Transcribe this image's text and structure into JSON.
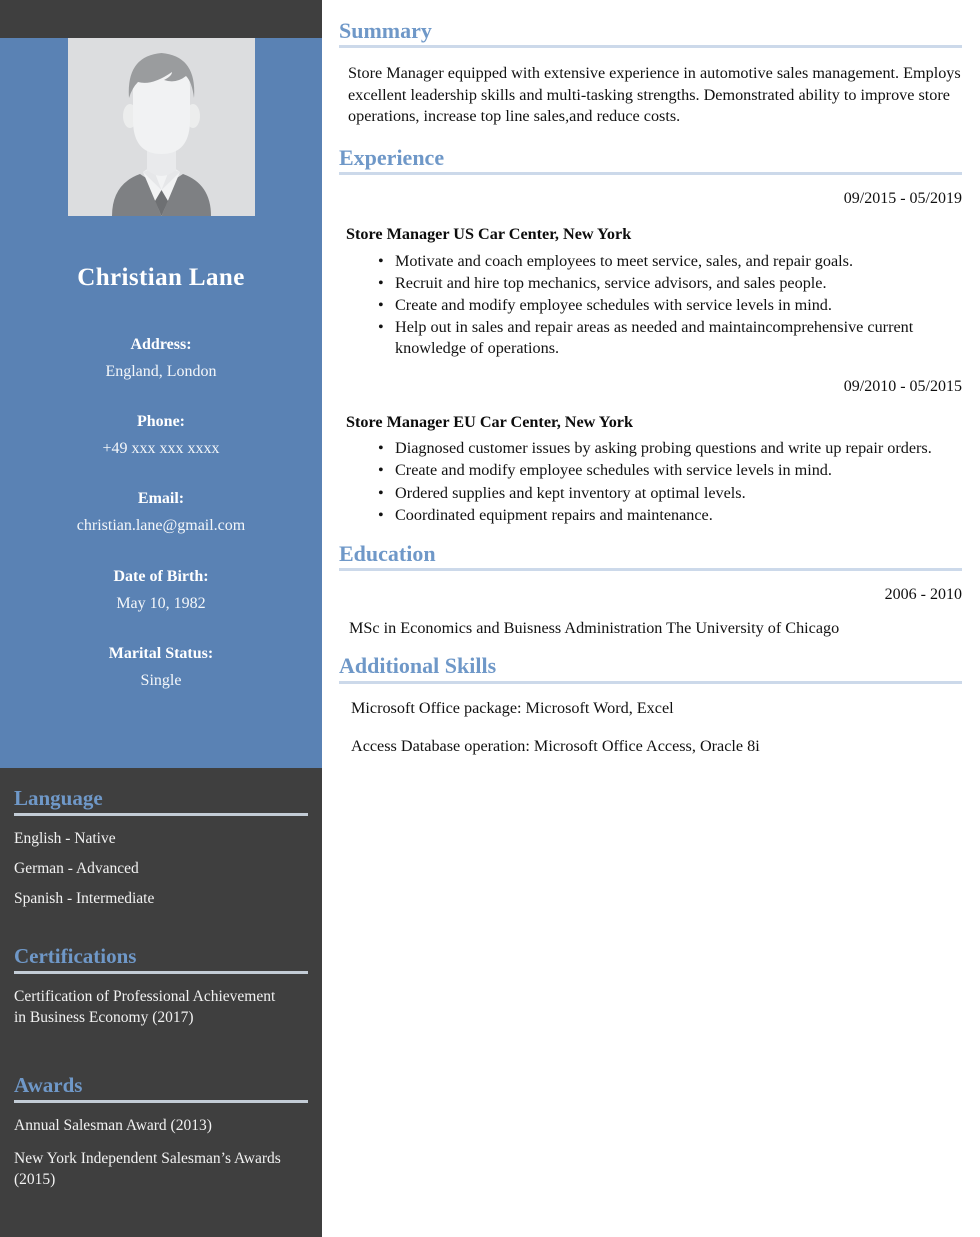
{
  "colors": {
    "sidebar_blue": "#5a82b4",
    "sidebar_dark": "#3f3f3f",
    "heading_blue": "#6f98c8",
    "rule_light_blue": "#ccd9ea",
    "rule_dark_panel": "#c3ccd6"
  },
  "sidebar": {
    "avatar_alt": "avatar-placeholder",
    "name": "Christian Lane",
    "contacts": [
      {
        "label": "Address:",
        "value": "England, London"
      },
      {
        "label": "Phone:",
        "value": "+49 xxx xxx xxxx"
      },
      {
        "label": "Email:",
        "value": "christian.lane@gmail.com"
      },
      {
        "label": "Date of Birth:",
        "value": "May 10, 1982"
      },
      {
        "label": "Marital Status:",
        "value": "Single"
      }
    ],
    "language": {
      "heading": "Language",
      "items": [
        "English - Native",
        "German - Advanced",
        "Spanish - Intermediate"
      ]
    },
    "certifications": {
      "heading": "Certifications",
      "items": [
        "Certification of Professional Achievement in Business Economy (2017)"
      ]
    },
    "awards": {
      "heading": "Awards",
      "items": [
        "Annual Salesman Award (2013)",
        "New York Independent Salesman’s Awards (2015)"
      ]
    }
  },
  "main": {
    "summary": {
      "heading": "Summary",
      "text": "Store Manager equipped with extensive experience in automotive sales management. Employs excellent leadership skills and multi-tasking strengths. Demonstrated ability to improve store operations, increase top line sales,and reduce costs."
    },
    "experience": {
      "heading": "Experience",
      "jobs": [
        {
          "date": "09/2015 - 05/2019",
          "title": "Store Manager US Car Center, New York",
          "bullets": [
            "Motivate and coach employees to meet service, sales, and repair goals.",
            "Recruit and hire top mechanics, service advisors, and sales people.",
            "Create and modify employee schedules with service levels in mind.",
            "Help out in sales and repair areas as needed and maintaincomprehensive current knowledge of operations."
          ]
        },
        {
          "date": "09/2010 - 05/2015",
          "title": "Store Manager EU Car Center, New York",
          "bullets": [
            "Diagnosed customer issues by asking probing questions and write up repair orders.",
            "Create and modify employee schedules with service levels in mind.",
            "Ordered supplies and kept inventory at optimal levels.",
            "Coordinated equipment repairs and maintenance."
          ]
        }
      ]
    },
    "education": {
      "heading": "Education",
      "date": "2006 - 2010",
      "entry": "MSc in Economics and Buisness Administration The University of Chicago"
    },
    "additional_skills": {
      "heading": "Additional Skills",
      "items": [
        "Microsoft Office package: Microsoft Word, Excel",
        "Access Database operation: Microsoft Office Access, Oracle 8i"
      ]
    }
  }
}
